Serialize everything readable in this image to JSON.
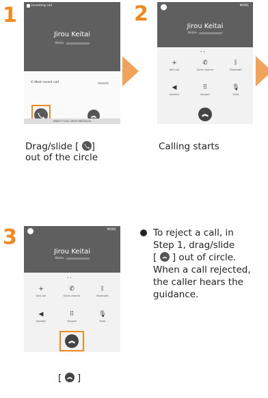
{
  "steps": [
    {
      "number": "1"
    },
    {
      "number": "2"
    },
    {
      "number": "3"
    }
  ],
  "screen1": {
    "status_text": "Incoming call",
    "caller_name": "Jirou Keitai",
    "mobile_label": "Mobile",
    "recent_label": "Most recent call",
    "reject_label": "REJECT CALL WITH MESSAGE"
  },
  "screen2": {
    "status_more": "MORE",
    "caller_name": "Jirou Keitai",
    "mobile_label": "Mobile",
    "controls": [
      {
        "label": "Add call",
        "icon": "plus-icon",
        "glyph": "+"
      },
      {
        "label": "Extra volume",
        "icon": "volume-boost-icon",
        "glyph": "✆"
      },
      {
        "label": "Bluetooth",
        "icon": "bluetooth-icon",
        "glyph": "ᛒ"
      },
      {
        "label": "Speaker",
        "icon": "speaker-icon",
        "glyph": "◀"
      },
      {
        "label": "Keypad",
        "icon": "keypad-icon",
        "glyph": "⠿"
      },
      {
        "label": "Mute",
        "icon": "mute-icon",
        "glyph": "🎙"
      }
    ]
  },
  "screen3": {
    "status_more": "MORE",
    "caller_name": "Jirou Keitai",
    "mobile_label": "Mobile",
    "controls": [
      {
        "label": "Add call",
        "icon": "plus-icon",
        "glyph": "+"
      },
      {
        "label": "Extra volume",
        "icon": "volume-boost-icon",
        "glyph": "✆"
      },
      {
        "label": "Bluetooth",
        "icon": "bluetooth-icon",
        "glyph": "ᛒ"
      },
      {
        "label": "Speaker",
        "icon": "speaker-icon",
        "glyph": "◀"
      },
      {
        "label": "Keypad",
        "icon": "keypad-icon",
        "glyph": "⠿"
      },
      {
        "label": "Mute",
        "icon": "mute-icon",
        "glyph": "🎙"
      }
    ]
  },
  "captions": {
    "step1_line1_prefix": "Drag/slide [",
    "step1_line1_suffix": "]",
    "step1_line2": "out of the circle",
    "step2": "Calling starts",
    "step3_prefix": "[",
    "step3_suffix": "]"
  },
  "note": {
    "line1": "To reject a call, in",
    "line2": "Step 1, drag/slide",
    "line3_prefix": "[",
    "line3_suffix": "] out of circle.",
    "line4": "When a call rejected,",
    "line5": "the caller hears the",
    "line6": "guidance."
  },
  "colors": {
    "accent": "#f08a1e",
    "arrow": "#f0a359",
    "header": "#5f5f5f"
  }
}
